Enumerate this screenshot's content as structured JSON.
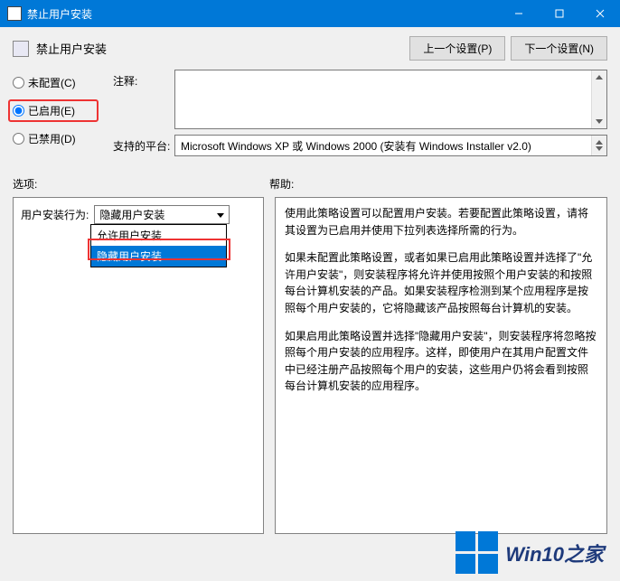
{
  "titlebar": {
    "title": "禁止用户安装"
  },
  "header": {
    "title": "禁止用户安装"
  },
  "nav": {
    "prev": "上一个设置(P)",
    "next": "下一个设置(N)"
  },
  "radios": {
    "not_configured": "未配置(C)",
    "enabled": "已启用(E)",
    "disabled": "已禁用(D)"
  },
  "comment": {
    "label": "注释:"
  },
  "platform": {
    "label": "支持的平台:",
    "value": "Microsoft Windows XP 或 Windows 2000 (安装有 Windows Installer v2.0)"
  },
  "sections": {
    "options": "选项:",
    "help": "帮助:"
  },
  "options": {
    "behavior_label": "用户安装行为:",
    "select_value": "隐藏用户安装",
    "dropdown": [
      "允许用户安装",
      "隐藏用户安装"
    ]
  },
  "help": {
    "p1": "使用此策略设置可以配置用户安装。若要配置此策略设置，请将其设置为已启用并使用下拉列表选择所需的行为。",
    "p2": "如果未配置此策略设置，或者如果已启用此策略设置并选择了\"允许用户安装\"，则安装程序将允许并使用按照个用户安装的和按照每台计算机安装的产品。如果安装程序检测到某个应用程序是按照每个用户安装的，它将隐藏该产品按照每台计算机的安装。",
    "p3": "如果启用此策略设置并选择\"隐藏用户安装\"，则安装程序将忽略按照每个用户安装的应用程序。这样，即使用户在其用户配置文件中已经注册产品按照每个用户的安装，这些用户仍将会看到按照每台计算机安装的应用程序。"
  },
  "watermark": {
    "text": "Win10之家"
  }
}
